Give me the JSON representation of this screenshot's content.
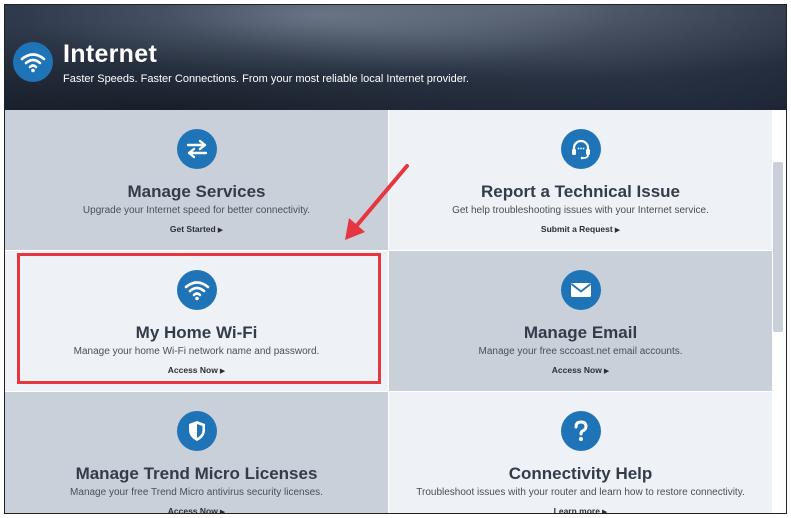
{
  "header": {
    "title": "Internet",
    "subtitle": "Faster Speeds. Faster Connections. From your most reliable local Internet provider.",
    "icon": "wifi-icon"
  },
  "colors": {
    "accent": "#1f73b7",
    "tile_dark": "#c9d0da",
    "tile_light": "#eef1f5",
    "highlight": "#e4373f"
  },
  "tiles": [
    {
      "title": "Manage Services",
      "description": "Upgrade your Internet speed for better connectivity.",
      "link": "Get Started",
      "icon": "swap-arrows-icon"
    },
    {
      "title": "Report a Technical Issue",
      "description": "Get help troubleshooting issues with your Internet service.",
      "link": "Submit a Request",
      "icon": "headset-icon"
    },
    {
      "title": "My Home Wi-Fi",
      "description": "Manage your home Wi-Fi network name and password.",
      "link": "Access Now",
      "icon": "wifi-icon"
    },
    {
      "title": "Manage Email",
      "description": "Manage your free sccoast.net email accounts.",
      "link": "Access Now",
      "icon": "envelope-icon"
    },
    {
      "title": "Manage Trend Micro Licenses",
      "description": "Manage your free Trend Micro antivirus security licenses.",
      "link": "Access Now",
      "icon": "shield-icon"
    },
    {
      "title": "Connectivity Help",
      "description": "Troubleshoot issues with your router and learn how to restore connectivity.",
      "link": "Learn more",
      "icon": "question-icon"
    }
  ]
}
